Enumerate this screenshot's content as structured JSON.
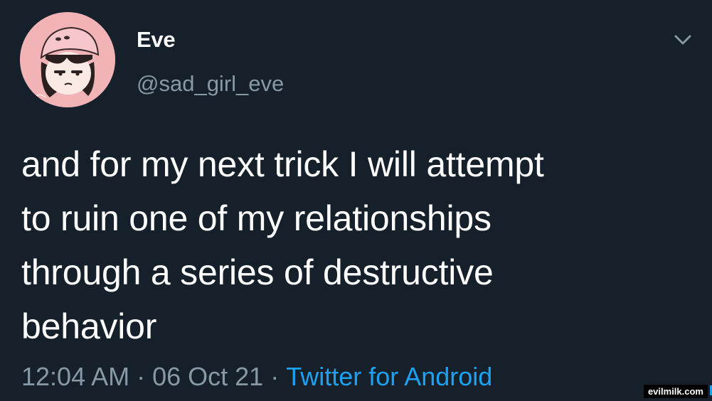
{
  "tweet": {
    "display_name": "Eve",
    "handle": "@sad_girl_eve",
    "text_lines": [
      "and for my next trick I will attempt",
      "to ruin one of my relationships",
      "through a series of destructive",
      "behavior"
    ],
    "time": "12:04 AM",
    "separator": "·",
    "date": "06 Oct 21",
    "source": "Twitter for Android"
  },
  "icons": {
    "menu": "chevron-down-icon",
    "avatar": "cartoon-girl-avatar"
  },
  "watermark": "evilmilk.com",
  "colors": {
    "background": "#15202b",
    "text": "#ffffff",
    "secondary": "#8899a6",
    "link": "#1da1f2",
    "avatar_bg": "#f2b3b6"
  }
}
